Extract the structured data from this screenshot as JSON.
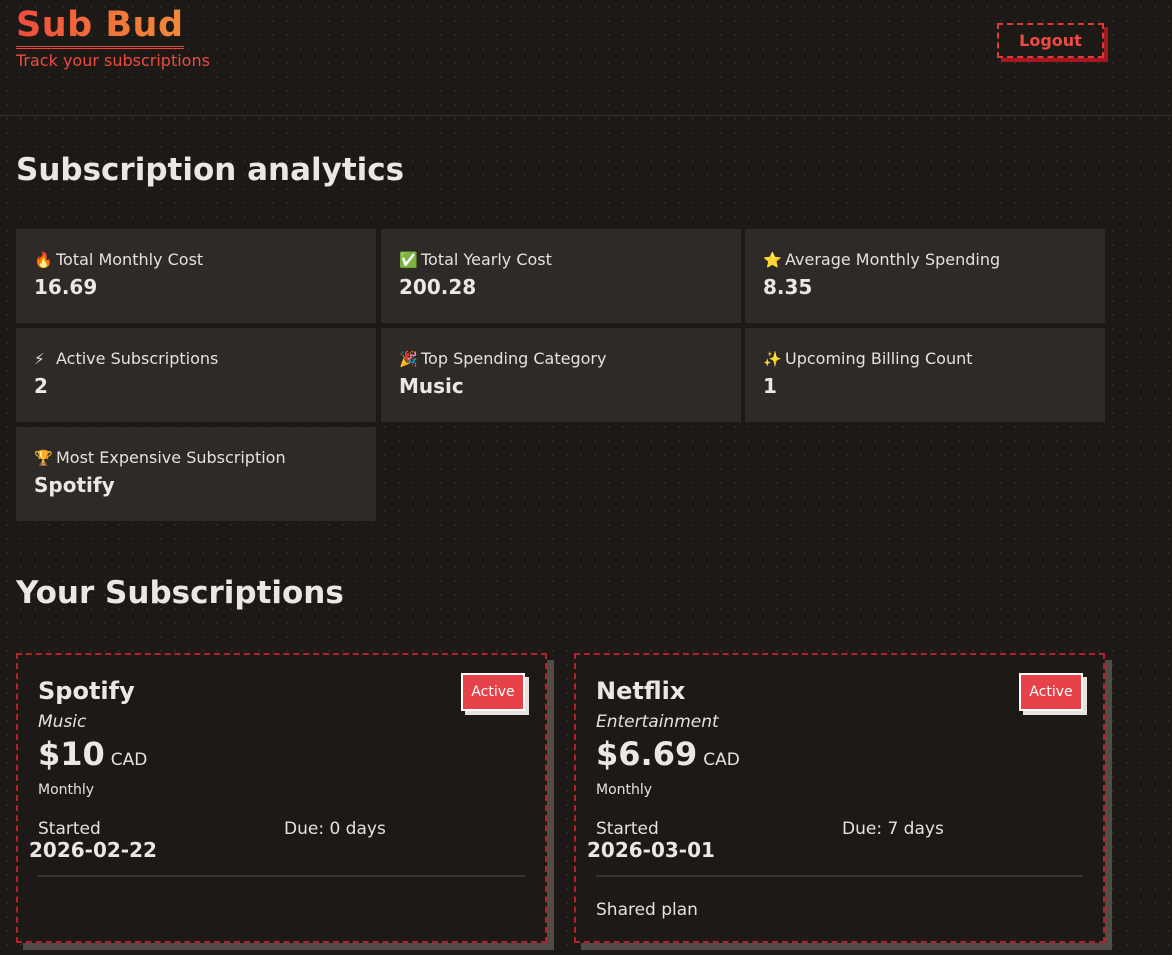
{
  "app": {
    "title": "Sub Bud",
    "subtitle": "Track your subscriptions",
    "logout_label": "Logout"
  },
  "colors": {
    "brand_gradient_start": "#ef4b3d",
    "brand_gradient_end": "#f08a3b",
    "accent_red": "#e0393d",
    "status_active": "#e7414a",
    "background": "#1d1917",
    "panel": "#2d2a28"
  },
  "analytics": {
    "heading": "Subscription analytics",
    "stats": [
      {
        "icon": "fire-icon",
        "glyph": "🔥",
        "label": "Total Monthly Cost",
        "value": "16.69"
      },
      {
        "icon": "check-icon",
        "glyph": "✅",
        "label": "Total Yearly Cost",
        "value": "200.28"
      },
      {
        "icon": "star-icon",
        "glyph": "⭐",
        "label": "Average Monthly Spending",
        "value": "8.35"
      },
      {
        "icon": "lightning-icon",
        "glyph": "⚡",
        "label": "Active Subscriptions",
        "value": "2"
      },
      {
        "icon": "party-popper-icon",
        "glyph": "🎉",
        "label": "Top Spending Category",
        "value": "Music"
      },
      {
        "icon": "sparkles-icon",
        "glyph": "✨",
        "label": "Upcoming Billing Count",
        "value": "1"
      },
      {
        "icon": "trophy-icon",
        "glyph": "🏆",
        "label": "Most Expensive Subscription",
        "value": "Spotify"
      }
    ]
  },
  "subscriptions": {
    "heading": "Your Subscriptions",
    "items": [
      {
        "name": "Spotify",
        "category": "Music",
        "price": "$10",
        "currency": "CAD",
        "cycle": "Monthly",
        "status": "Active",
        "started_label": "Started",
        "started_date": "2026-02-22",
        "due": "Due: 0 days",
        "note": ""
      },
      {
        "name": "Netflix",
        "category": "Entertainment",
        "price": "$6.69",
        "currency": "CAD",
        "cycle": "Monthly",
        "status": "Active",
        "started_label": "Started",
        "started_date": "2026-03-01",
        "due": "Due: 7 days",
        "note": "Shared plan"
      }
    ]
  }
}
